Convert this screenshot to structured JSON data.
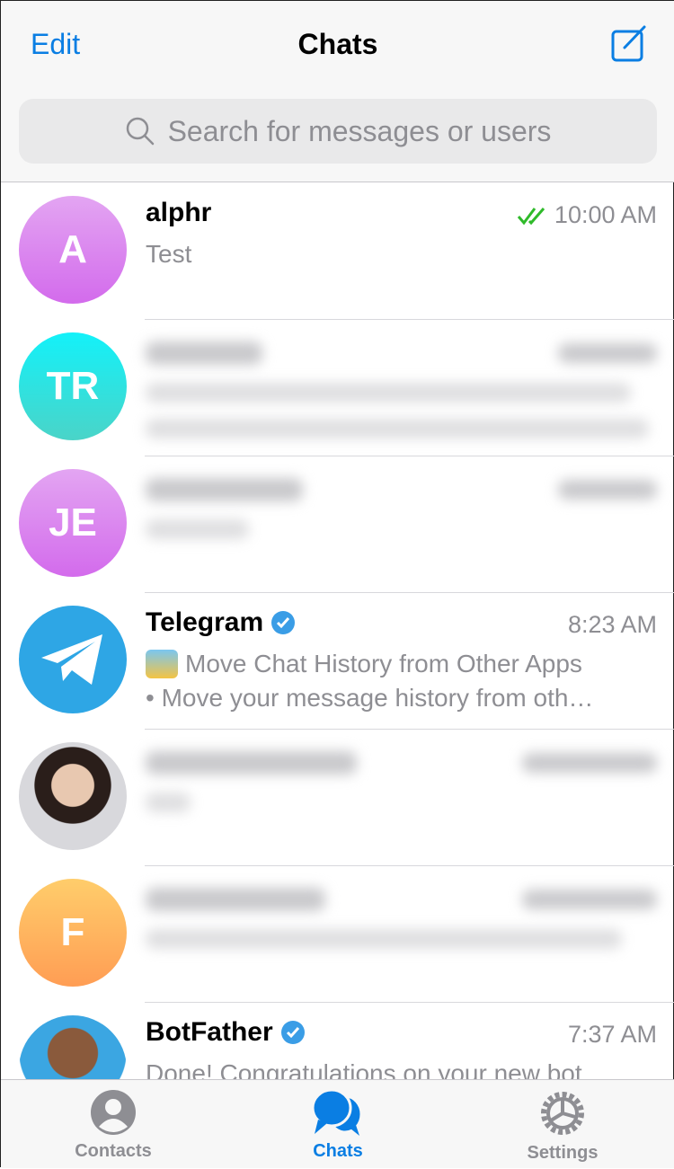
{
  "header": {
    "edit_label": "Edit",
    "title": "Chats",
    "compose_icon": "compose-icon"
  },
  "search": {
    "placeholder": "Search for messages or users"
  },
  "colors": {
    "accent": "#0a7ee3",
    "read_check": "#2fba2a",
    "verified": "#3a9de6"
  },
  "chats": [
    {
      "initials": "A",
      "name": "alphr",
      "time": "10:00 AM",
      "message": "Test",
      "read": true,
      "gradient": [
        "#e3a5f2",
        "#d36bec"
      ]
    },
    {
      "initials": "TR",
      "blurred": true,
      "gradient": [
        "#13f1f9",
        "#4ad4c8"
      ]
    },
    {
      "initials": "JE",
      "blurred": true,
      "gradient": [
        "#e3a5f2",
        "#d36bec"
      ]
    },
    {
      "name": "Telegram",
      "verified": true,
      "time": "8:23 AM",
      "message": "Move Chat History from Other Apps",
      "message2": "• Move your message history from oth…"
    },
    {
      "blurred": true,
      "photo": true
    },
    {
      "initials": "F",
      "blurred": true,
      "gradient": [
        "#ffcd6b",
        "#ff9d54"
      ]
    },
    {
      "name": "BotFather",
      "verified": true,
      "time": "7:37 AM",
      "message": "Done! Congratulations on your new bot."
    }
  ],
  "tabs": [
    {
      "label": "Contacts"
    },
    {
      "label": "Chats",
      "active": true
    },
    {
      "label": "Settings"
    }
  ]
}
